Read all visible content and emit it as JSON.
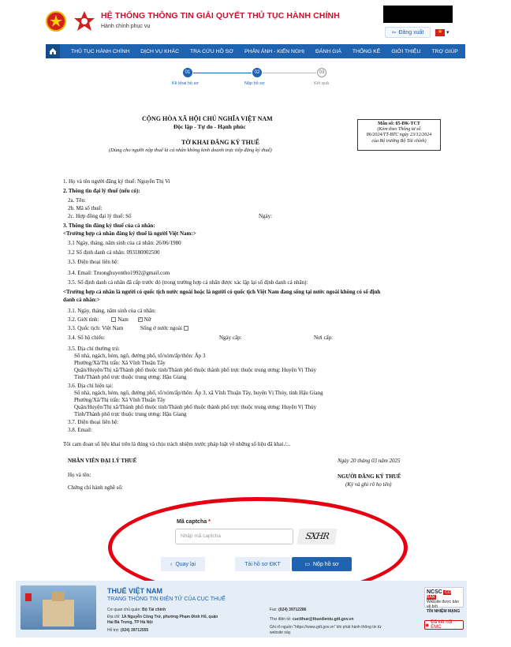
{
  "header": {
    "system_name": "HỆ THỐNG THÔNG TIN GIẢI QUYẾT THỦ TỤC HÀNH CHÍNH",
    "subtitle": "Hành chính phục vụ",
    "logout_label": "Đăng xuất"
  },
  "nav": {
    "items": [
      "THỦ TỤC HÀNH CHÍNH",
      "DỊCH VỤ KHÁC",
      "TRA CỨU HỒ SƠ",
      "PHẢN ÁNH - KIẾN NGHỊ",
      "ĐÁNH GIÁ",
      "THỐNG KÊ",
      "GIỚI THIỆU",
      "TRỢ GIÚP"
    ]
  },
  "stepper": {
    "steps": [
      {
        "num": "01",
        "label": "Kê khai hồ sơ"
      },
      {
        "num": "02",
        "label": "Nộp hồ sơ"
      },
      {
        "num": "03",
        "label": "Kết quả"
      }
    ]
  },
  "document": {
    "nation": "CỘNG HÒA XÃ HỘI CHỦ NGHĨA VIỆT NAM",
    "motto": "Độc lập - Tự do - Hạnh phúc",
    "form_title": "TỜ KHAI ĐĂNG KÝ THUẾ",
    "form_note": "(Dùng cho người nộp thuế là cá nhân không kinh doanh trực tiếp đăng ký thuế)",
    "form_code": "Mẫu số: 05-ĐK-TCT",
    "form_code_note1": "(Kèm theo Thông tư số",
    "form_code_note2": "86/2024/TT-BTC ngày 23/12/2024",
    "form_code_note3": "của Bộ trưởng Bộ Tài chính)",
    "l1": "1. Họ và tên người đăng ký thuế:  Nguyễn Thị Vi",
    "l2": "2. Thông tin đại lý thuế (nếu có):",
    "l2a": "2a. Tên:",
    "l2b": "2b. Mã số thuế:",
    "l2c": "2c. Hợp đồng đại lý thuế: Số",
    "l2c_date": "Ngày:",
    "l3": "3. Thông tin đăng ký thuế của cá nhân:",
    "l3_sub": "<Trường hợp cá nhân đăng ký thuế là người Việt Nam:>",
    "l31": "3.1 Ngày, tháng, năm sinh của cá nhân:  26/06/1980",
    "l32": "3.2 Số định danh cá nhân:  093180002500",
    "l33": "3.3. Điện thoại liên hệ:",
    "l34": "3.4. Email:   Truonghuyentho1992@gmail.com",
    "l35": "3.5. Số định danh cá nhân đã cấp trước đó (trong trường hợp cá nhân được xác lập lại số định danh cá nhân):",
    "l_foreign1": "<Trường hợp cá nhân là người có quốc tịch nước ngoài hoặc là người có quốc tịch Việt Nam đang sống tại nước ngoài không có số định",
    "l_foreign2": "danh cá nhân:>",
    "f31": "3.1. Ngày, tháng, năm sinh của cá nhân:",
    "f32": "3.2. Giới tính:",
    "f32_male": "Nam",
    "f32_female": "Nữ",
    "f33": "3.3. Quốc tịch: Việt Nam",
    "f33b": "Sống ở nước ngoài",
    "f34": "3.4. Số hộ chiếu:",
    "f34_date": "Ngày cấp:",
    "f34_place": "Nơi cấp:",
    "f35": "3.5. Địa chỉ thường trú:",
    "f35a": "Số nhà, ngách, hẻm, ngõ, đường phố, tổ/xóm/ấp/thôn:   Ấp 3",
    "f35b": "Phường/Xã/Thị trấn: Xã Vĩnh Thuận Tây",
    "f35c": "Quận/Huyện/Thị xã/Thành phố thuộc tỉnh/Thành phố thuộc thành phố trực thuộc trung ương: Huyện Vị Thủy",
    "f35d": "Tỉnh/Thành phố trực thuộc trung ương: Hậu Giang",
    "f36": "3.6. Địa chỉ hiện tại:",
    "f36a": "Số nhà, ngách, hẻm, ngõ, đường phố, tổ/xóm/ấp/thôn:   Ấp 3, xã Vĩnh Thuận Tây, huyện Vị Thủy, tỉnh Hậu Giang",
    "f36b": "Phường/Xã/Thị trấn: Xã Vĩnh Thuận Tây",
    "f36c": "Quận/Huyện/Thị xã/Thành phố thuộc tỉnh/Thành phố thuộc thành phố trực thuộc trung ương: Huyện Vị Thủy",
    "f36d": "Tỉnh/Thành phố trực thuộc trung ương: Hậu Giang",
    "f37": "3.7. Điện thoại liên hệ:",
    "f38": "3.8. Email:",
    "commit": "Tôi cam đoan số liệu khai trên là đúng và chịu trách nhiệm trước pháp luật về những số liệu đã khai./...",
    "agent_title": "NHÂN VIÊN ĐẠI LÝ THUẾ",
    "agent_name": "Họ và tên:",
    "agent_cert": "Chứng chỉ hành nghề số:",
    "date_line": "Ngày 20 tháng 03 năm 2025",
    "signer_title": "NGƯỜI ĐĂNG KÝ THUẾ",
    "signer_note": "(Ký và ghi rõ họ tên)"
  },
  "captcha": {
    "label": "Mã captcha",
    "required_mark": "*",
    "placeholder": "Nhập mã captcha",
    "image_text": "SXHR"
  },
  "buttons": {
    "back": "Quay lại",
    "download": "Tải hồ sơ ĐKT",
    "submit": "Nộp hồ sơ"
  },
  "footer": {
    "title": "THUẾ VIỆT NAM",
    "subtitle": "TRANG THÔNG TIN ĐIỆN TỬ CỦA CỤC THUẾ",
    "agency_label": "Cơ quan chủ quản:",
    "agency": "Bộ Tài chính",
    "address_label": "Địa chỉ:",
    "address1": "1A Nguyễn Công Trứ, phường Phạm Đình Hổ, quận",
    "address2": "Hai Bà Trưng, TP Hà Nội",
    "hotline_label": "Hỗ trợ:",
    "hotline": "(024) 39712555",
    "fax_label": "Fax:",
    "fax": "(024) 39712286",
    "email_label": "Thư điện tử:",
    "email": "cuctthue@thuedientu.gdt.gov.vn",
    "note1": "Ghi rõ nguồn \"https://www.gdt.gov.vn\" khi phát hành thông tin từ",
    "note2": "website này.",
    "ncsc_label": "NCSC",
    "ncsc_badge": "CƠ BẢN",
    "ncsc_text": "Website được bảo vệ bởi",
    "ncsc_trust": "TÍN NHIỆM MẠNG",
    "emc": "Đã kết nối EMC"
  },
  "colors": {
    "brand_blue": "#1f62b0",
    "accent_red": "#c8102e",
    "highlight_ring": "#e60012"
  }
}
